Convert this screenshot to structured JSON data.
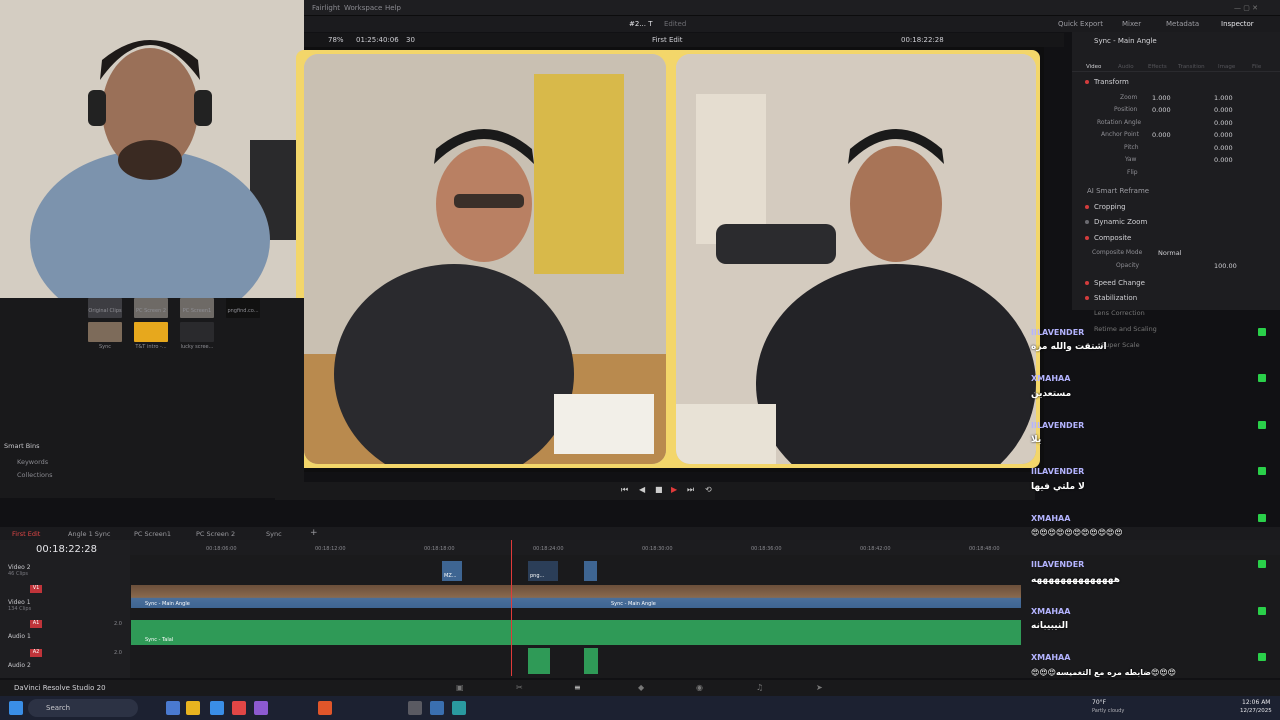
{
  "menu": {
    "items": [
      "Fairlight",
      "Workspace",
      "Help"
    ]
  },
  "header": {
    "project": "#2... T",
    "status": "Edited",
    "tools": [
      "Quick Export",
      "Mixer",
      "Metadata",
      "Inspector"
    ]
  },
  "viewer": {
    "zoom": "78%",
    "source_tc": "01:25:40:06",
    "fps": "30",
    "timeline_name": "First Edit",
    "record_tc": "00:18:22:28"
  },
  "inspector": {
    "title": "Sync - Main Angle",
    "tabs": [
      "Video",
      "Audio",
      "Effects",
      "Transition",
      "Image",
      "File"
    ],
    "sections": [
      "Transform",
      "AI Smart Reframe",
      "Cropping",
      "Dynamic Zoom",
      "Composite",
      "Speed Change",
      "Stabilization",
      "Lens Correction",
      "Retime and Scaling",
      "Super Scale"
    ],
    "params": {
      "zoom_label": "Zoom",
      "zoom_x": "1.000",
      "zoom_y": "1.000",
      "position_label": "Position",
      "position_x": "0.000",
      "position_y": "0.000",
      "rotation_label": "Rotation Angle",
      "rotation": "0.000",
      "anchor_label": "Anchor Point",
      "anchor_x": "0.000",
      "anchor_y": "0.000",
      "pitch_label": "Pitch",
      "pitch": "0.000",
      "yaw_label": "Yaw",
      "yaw": "0.000",
      "flip_label": "Flip",
      "composite_mode_label": "Composite Mode",
      "composite_mode": "Normal",
      "opacity_label": "Opacity",
      "opacity": "100.00"
    }
  },
  "media_pool": {
    "clips_top": [
      "Original Clips",
      "PC Screen 2",
      "PC Screen1",
      "pngfind.co..."
    ],
    "clips": [
      "Sync",
      "T&T intro -...",
      "lucky scree..."
    ],
    "smart_bins": "Smart Bins",
    "bins": [
      "Keywords",
      "Collections"
    ]
  },
  "timeline": {
    "tabs": [
      "First Edit",
      "Angle 1 Sync",
      "PC Screen1",
      "PC Screen 2",
      "Sync"
    ],
    "timecode": "00:18:22:28",
    "ruler": [
      "00:18:06:00",
      "00:18:12:00",
      "00:18:18:00",
      "00:18:24:00",
      "00:18:30:00",
      "00:18:36:00",
      "00:18:42:00",
      "00:18:48:00"
    ],
    "tracks": [
      {
        "id": "",
        "name": "Video 2",
        "count": "46 Clips"
      },
      {
        "id": "V1",
        "name": "Video 1",
        "count": "134 Clips"
      },
      {
        "id": "A1",
        "name": "Audio 1",
        "level": "2.0"
      },
      {
        "id": "A2",
        "name": "Audio 2",
        "level": "2.0"
      }
    ],
    "clip_labels": [
      "Sync - Main Angle",
      "Sync - Talal",
      "MZ...",
      "png...",
      "Sync - Main Angle"
    ]
  },
  "chat": [
    {
      "user": "IILAVENDER",
      "msg": "اشتقت والله مره"
    },
    {
      "user": "XMAHAA",
      "msg": "مستعدين"
    },
    {
      "user": "IILAVENDER",
      "msg": "يلا"
    },
    {
      "user": "IILAVENDER",
      "msg": "لا ملتي فيها"
    },
    {
      "user": "XMAHAA",
      "msg": "😍😍😍😍😍😍😍😍😍😍😍"
    },
    {
      "user": "IILAVENDER",
      "msg": "ههههههههههههههه"
    },
    {
      "user": "XMAHAA",
      "msg": "النيبيبانه"
    },
    {
      "user": "XMAHAA",
      "msg": "😍😍😍ضابطه مره مع التغميسه😍😍😍"
    }
  ],
  "app": {
    "name": "DaVinci Resolve Studio 20"
  },
  "taskbar": {
    "search": "Search",
    "weather_temp": "70°F",
    "weather_desc": "Partly cloudy",
    "time": "12:06 AM",
    "date": "12/27/2025"
  }
}
